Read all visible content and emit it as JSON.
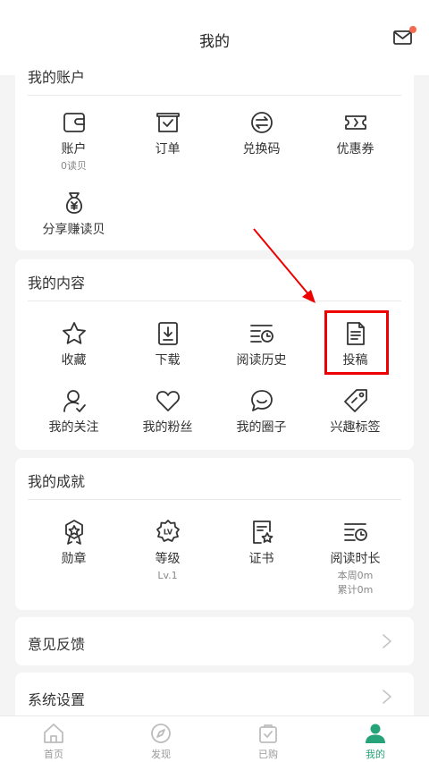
{
  "header": {
    "title": "我的"
  },
  "account": {
    "title": "我的账户",
    "items": [
      {
        "label": "账户",
        "sub": "0读贝",
        "icon": "wallet-icon"
      },
      {
        "label": "订单",
        "icon": "order-icon"
      },
      {
        "label": "兑换码",
        "icon": "exchange-icon"
      },
      {
        "label": "优惠券",
        "icon": "coupon-icon"
      },
      {
        "label": "分享赚读贝",
        "icon": "money-bag-icon"
      }
    ]
  },
  "content": {
    "title": "我的内容",
    "items": [
      {
        "label": "收藏",
        "icon": "star-icon"
      },
      {
        "label": "下载",
        "icon": "download-icon"
      },
      {
        "label": "阅读历史",
        "icon": "history-icon"
      },
      {
        "label": "投稿",
        "icon": "document-icon"
      },
      {
        "label": "我的关注",
        "icon": "user-check-icon"
      },
      {
        "label": "我的粉丝",
        "icon": "heart-icon"
      },
      {
        "label": "我的圈子",
        "icon": "chat-bubble-icon"
      },
      {
        "label": "兴趣标签",
        "icon": "tag-icon"
      }
    ]
  },
  "achievement": {
    "title": "我的成就",
    "items": [
      {
        "label": "勋章",
        "icon": "medal-icon"
      },
      {
        "label": "等级",
        "sub": "Lv.1",
        "icon": "level-badge-icon"
      },
      {
        "label": "证书",
        "icon": "certificate-icon"
      },
      {
        "label": "阅读时长",
        "sub1": "本周0m",
        "sub2": "累计0m",
        "icon": "reading-time-icon"
      }
    ]
  },
  "rows": [
    {
      "label": "意见反馈"
    },
    {
      "label": "系统设置"
    }
  ],
  "tabs": [
    {
      "label": "首页",
      "icon": "home-icon"
    },
    {
      "label": "发现",
      "icon": "compass-icon"
    },
    {
      "label": "已购",
      "icon": "purchased-bag-icon"
    },
    {
      "label": "我的",
      "icon": "profile-icon"
    }
  ],
  "colors": {
    "accent": "#27a37a",
    "highlight": "#e00000",
    "notification": "#f26b4f"
  }
}
